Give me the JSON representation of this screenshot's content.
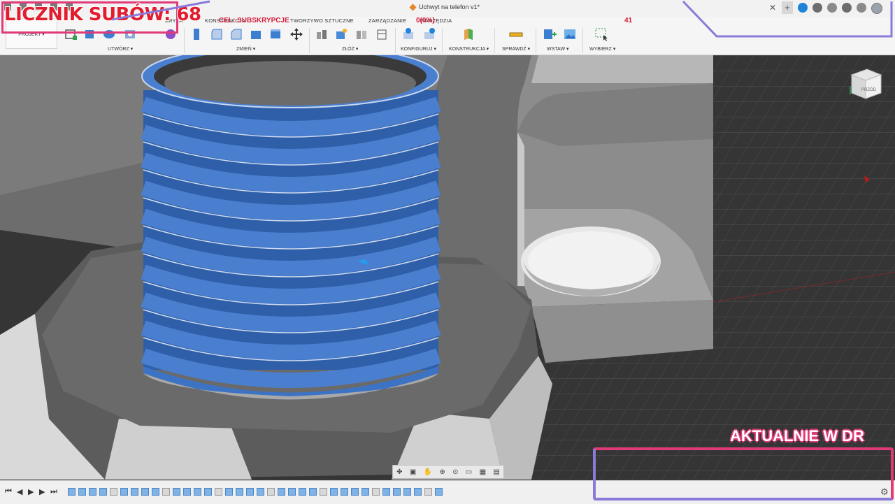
{
  "window": {
    "doc_title": "Uchwyt na telefon v1*",
    "close_label": "✕",
    "new_tab_label": "+"
  },
  "toolbar": {
    "workspace_label": "PROJEKT ▾",
    "tabs": [
      {
        "label": "BRYŁA"
      },
      {
        "label": "KONSTRUKCJA"
      },
      {
        "label": "TWORZYWO SZTUCZNE"
      },
      {
        "label": "ZARZĄDZANIE"
      },
      {
        "label": "NARZĘDZIA"
      }
    ],
    "groups": [
      {
        "label": "UTWÓRZ ▾"
      },
      {
        "label": "ZMIEŃ ▾"
      },
      {
        "label": "ZŁÓŻ ▾"
      },
      {
        "label": "KONFIGURUJ ▾"
      },
      {
        "label": "KONSTRUKCJA ▾"
      },
      {
        "label": "SPRAWDŹ ▾"
      },
      {
        "label": "WSTAW ▾"
      },
      {
        "label": "WYBIERZ ▾"
      }
    ]
  },
  "overlay": {
    "sub_counter": "LICZNIK SUBÓW: 68",
    "goal_label": "CEL: SUBSKRYPCJE",
    "goal_value": "0(0%)",
    "goal_target": "41",
    "aktualnie": "AKTUALNIE W DR"
  },
  "viewcube": {
    "face_label": "PRZÓD"
  },
  "timeline": {
    "item_count": 36
  },
  "colors": {
    "selection_blue": "#3d73c4",
    "overlay_pink": "#e13a78",
    "counter_red": "#e11d2f"
  }
}
